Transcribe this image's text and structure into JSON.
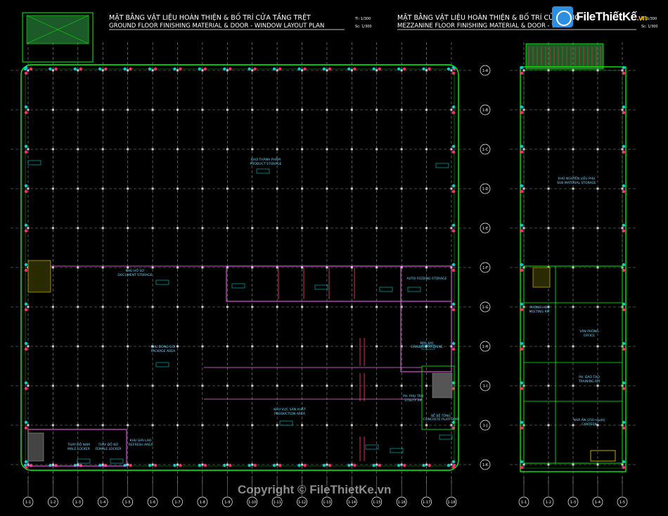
{
  "ground_plan": {
    "title_vn": "MẶT BẰNG VẬT LIỆU HOÀN THIỆN & BỐ TRÍ CỬA TẦNG TRỆT",
    "title_en": "GROUND FLOOR FINISHING MATERIAL & DOOR - WINDOW LAYOUT PLAN",
    "scale_1": "Tl: 1/300",
    "scale_2": "Sc: 1/300",
    "rooms": [
      {
        "id": "kho-thanh-pham",
        "line1": "KHO THÀNH PHẨM",
        "line2": "PRODUCT STORAGE"
      },
      {
        "id": "khu-dong-goi",
        "line1": "KHU ĐÓNG GÓI",
        "line2": "PACKAGE AREA"
      },
      {
        "id": "khu-vuc-san-xuat",
        "line1": "KHU VỰC SẢN XUẤT",
        "line2": "PRODUCTION AREA"
      },
      {
        "id": "auto-feeding",
        "line1": "AUTO FEEDING STORAGE",
        "line2": ""
      },
      {
        "id": "may-xat",
        "line1": "MÁY XAY",
        "line2": "GRINDING MACHINE"
      },
      {
        "id": "ph-phu-tro",
        "line1": "PH. PHỤ TRỢ",
        "line2": "UTILITY RM"
      },
      {
        "id": "be-be-tong",
        "line1": "BỂ BÊ TÔNG",
        "line2": "CONCRETE PLATFORM"
      },
      {
        "id": "phong-thay-do-nam",
        "line1": "THAY ĐỒ NAM",
        "line2": "MALE LOCKER"
      },
      {
        "id": "phong-thay-do-nu",
        "line1": "THAY ĐỒ NỮ",
        "line2": "FEMALE LOCKER"
      },
      {
        "id": "khu-giai-lao",
        "line1": "KHU GIẢI LAO",
        "line2": "REFRESH AREA"
      },
      {
        "id": "kho-ho-so",
        "line1": "KHO HỒ SƠ",
        "line2": "DOCUMENT STORAGE"
      }
    ],
    "col_labels": [
      "1-1",
      "1-2",
      "1-3",
      "1-4",
      "1-5",
      "1-6",
      "1-7",
      "1-8",
      "1-9",
      "1-10",
      "1-11",
      "1-12",
      "1-13",
      "1-14",
      "1-15",
      "1-16",
      "1-17",
      "1-18"
    ],
    "row_labels": [
      "1-A",
      "1-B",
      "1-C",
      "1-D",
      "1-E",
      "1-F",
      "1-G",
      "1-H",
      "1-I",
      "1-J",
      "1-K"
    ]
  },
  "mezz_plan": {
    "title_vn": "MẶT BẰNG VẬT LIỆU HOÀN THIỆN & BỐ TRÍ CỬA TẦNG",
    "title_en": "MEZZANINE FLOOR FINISHING MATERIAL & DOOR - W",
    "scale_1": "Tl: 1/300",
    "scale_2": "Sc: 1/300",
    "rooms": [
      {
        "id": "kho-nguyen-lieu-phu",
        "line1": "KHO NGUYÊN LIỆU PHỤ",
        "line2": "SUB MATERIAL STORAGE"
      },
      {
        "id": "van-phong",
        "line1": "VĂN PHÒNG",
        "line2": "OFFICE"
      },
      {
        "id": "ph-dao-tao",
        "line1": "PH. ĐÀO TẠO",
        "line2": "TRAINING RM"
      },
      {
        "id": "nha-an",
        "line1": "NHÀ ĂN (250 người)",
        "line2": "CANTEEN"
      },
      {
        "id": "phong-hop",
        "line1": "PHÒNG HỌP",
        "line2": "MEETING RM"
      }
    ],
    "col_labels": [
      "1-1",
      "1-2",
      "1-3",
      "1-4",
      "1-5"
    ]
  },
  "logo": {
    "text": "FileThiếtKế",
    "domain": ".vn"
  },
  "watermark": "Copyright © FileThietKe.vn",
  "colors": {
    "background": "#000000",
    "grid": "#8f8f8f",
    "wall": "#00ff00",
    "partition": "#ff66ff",
    "text": "#ffffff",
    "room_label": "#6fd6ff",
    "tag": "#00c8c8"
  }
}
